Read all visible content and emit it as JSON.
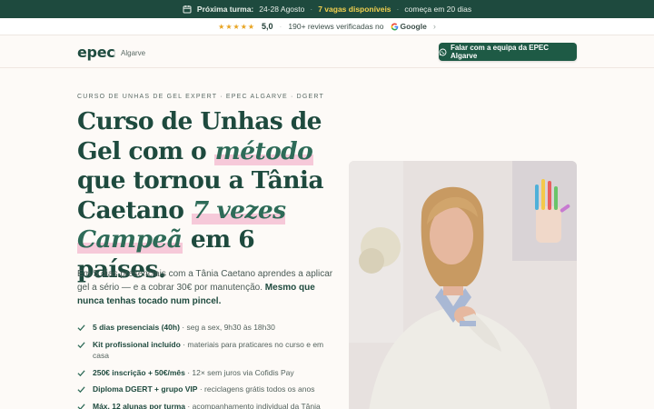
{
  "announcement": {
    "label": "Próxima turma:",
    "dates": "24-28 Agosto",
    "spots": "7 vagas disponíveis",
    "starts": "começa em 20 dias"
  },
  "reviews": {
    "stars": "★★★★★",
    "rating": "5,0",
    "text": "190+ reviews verificadas no",
    "platform": "Google"
  },
  "header": {
    "logo": "epec",
    "location": "Algarve",
    "cta_label": "Falar com a equipa da EPEC Algarve"
  },
  "hero": {
    "eyebrow": "CURSO DE UNHAS DE GEL EXPERT · EPEC ALGARVE · DGERT",
    "headline": {
      "part1": "Curso de Unhas de Gel com o ",
      "em1": "método",
      "part2": " que tornou a Tânia Caetano ",
      "em2": "7 vezes Campeã",
      "part3": " em 6 países."
    },
    "lead": {
      "text": "Em 5 dias presenciais com a Tânia Caetano aprendes a aplicar gel a sério — e a cobrar 30€ por manutenção. ",
      "bold": "Mesmo que nunca tenhas tocado num pincel."
    },
    "features": [
      {
        "bold": "5 dias presenciais (40h)",
        "text": " · seg a sex, 9h30 às 18h30"
      },
      {
        "bold": "Kit profissional incluído",
        "text": " · materiais para praticares no curso e em casa"
      },
      {
        "bold": "250€ inscrição + 50€/mês",
        "text": " · 12× sem juros via Cofidis Pay"
      },
      {
        "bold": "Diploma DGERT + grupo VIP",
        "text": " · reciclagens grátis todos os anos"
      },
      {
        "bold": "Máx. 12 alunas por turma",
        "text": " · acompanhamento individual da Tânia"
      }
    ]
  },
  "icons": {
    "calendar": "calendar-icon",
    "whatsapp": "whatsapp-icon",
    "check": "check-icon",
    "google": "google-icon",
    "chevron": "chevron-right-icon"
  },
  "colors": {
    "brand_green": "#1e4a3e",
    "cta_green": "#1e5a45",
    "highlight_yellow": "#f2d04e",
    "highlight_pink": "#f6c9d9",
    "star": "#e8a320"
  }
}
